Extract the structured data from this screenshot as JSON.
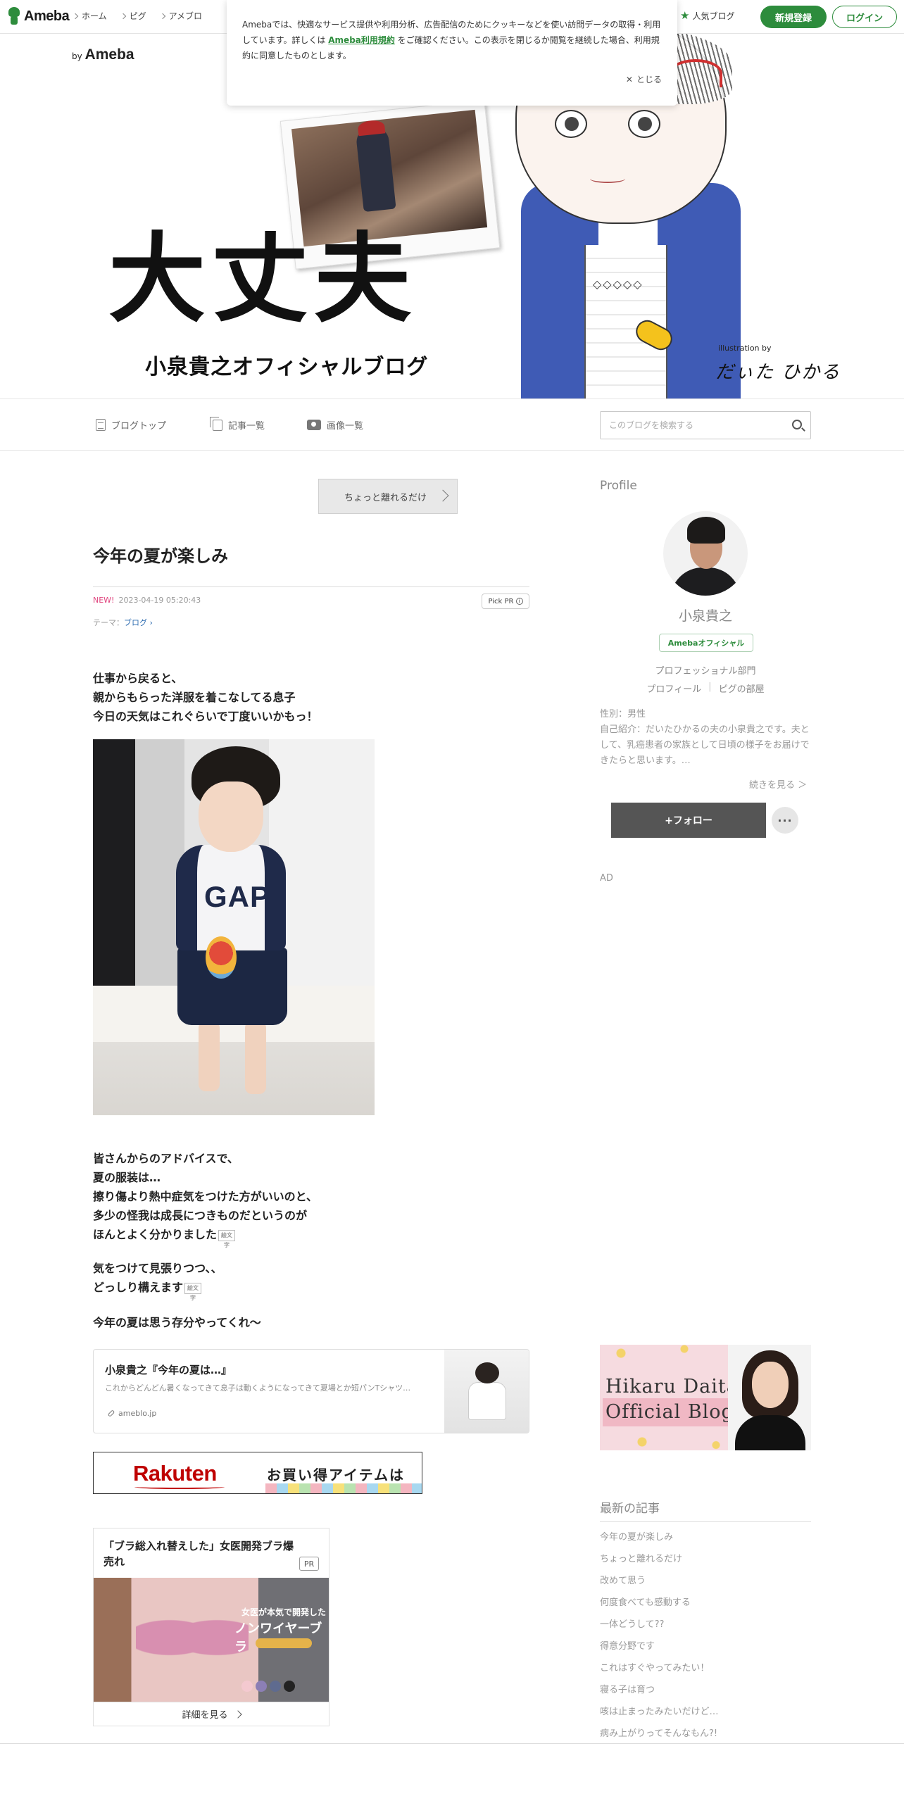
{
  "topnav": {
    "logo_text": "Ameba",
    "links": [
      "ホーム",
      "ピグ",
      "アメブロ"
    ],
    "popular": "人気ブログ",
    "register": "新規登録",
    "login": "ログイン"
  },
  "banner": {
    "by": "by",
    "brand": "Ameba",
    "title": "大丈夫",
    "subtitle": "小泉貴之オフィシャルブログ",
    "illustration_credit": "illustration by",
    "illustrator": "だぃた ひかる"
  },
  "cookie": {
    "text_before": "Amebaでは、快適なサービス提供や利用分析、広告配信のためにクッキーなどを使い訪問データの取得・利用しています。詳しくは ",
    "link": "Ameba利用規約",
    "text_after": " をご確認ください。この表示を閉じるか閲覧を継続した場合、利用規約に同意したものとします。",
    "close": "とじる"
  },
  "blognav": {
    "top": "ブログトップ",
    "list": "記事一覧",
    "images": "画像一覧",
    "search_placeholder": "このブログを検索する"
  },
  "article": {
    "prev_button": "ちょっと離れるだけ",
    "title": "今年の夏が楽しみ",
    "new_badge": "NEW!",
    "datetime": "2023-04-19 05:20:43",
    "pick_pr": "Pick PR",
    "theme_label": "テーマ：",
    "theme": "ブログ",
    "para1": [
      "仕事から戻ると、",
      "親からもらった洋服を着こなしてる息子",
      "今日の天気はこれぐらいで丁度いいかもっ！"
    ],
    "para2": [
      "皆さんからのアドバイスで、",
      "夏の服装は…",
      "擦り傷より熱中症気をつけた方がいいのと、",
      "多少の怪我は成長につきものだというのが",
      "ほんとよく分かりました"
    ],
    "para3": [
      "気をつけて見張りつつ、、",
      "どっしり構えます"
    ],
    "para4": "今年の夏は思う存分やってくれ〜",
    "emoji_alt": "絵文字",
    "linkcard": {
      "title": "小泉貴之『今年の夏は…』",
      "desc": "これからどんどん暑くなってきて息子は動くようになってきて夏場とか短パンTシャツ…",
      "domain": "ameblo.jp"
    },
    "rakuten": {
      "logo": "Rakuten",
      "text": "お買い得アイテムは"
    },
    "ad": {
      "title": "「ブラ総入れ替えした」女医開発ブラ爆売れ",
      "pr": "PR",
      "copy1": "女医が本気で開発した",
      "copy2": "ノンワイヤーブラ",
      "more": "詳細を見る"
    }
  },
  "sidebar": {
    "profile_heading": "Profile",
    "name": "小泉貴之",
    "official": "Amebaオフィシャル",
    "category": "プロフェッショナル部門",
    "links": [
      "プロフィール",
      "ピグの部屋"
    ],
    "gender": "性別：男性",
    "bio": "自己紹介：だいたひかるの夫の小泉貴之です。夫として、乳癌患者の家族として日頃の様子をお届けできたらと思います。…",
    "more": "続きを見る ＞",
    "follow": "+フォロー",
    "more_menu": "···",
    "ad_label": "AD",
    "hikaru_line1": "Hikaru Daita",
    "hikaru_line2": "Official Blog",
    "recent_heading": "最新の記事",
    "recent": [
      "今年の夏が楽しみ",
      "ちょっと離れるだけ",
      "改めて思う",
      "何度食べても感動する",
      "一体どうして??",
      "得意分野です",
      "これはすぐやってみたい！",
      "寝る子は育つ",
      "咳は止まったみたいだけど…",
      "病み上がりってそんなもん?!"
    ]
  }
}
